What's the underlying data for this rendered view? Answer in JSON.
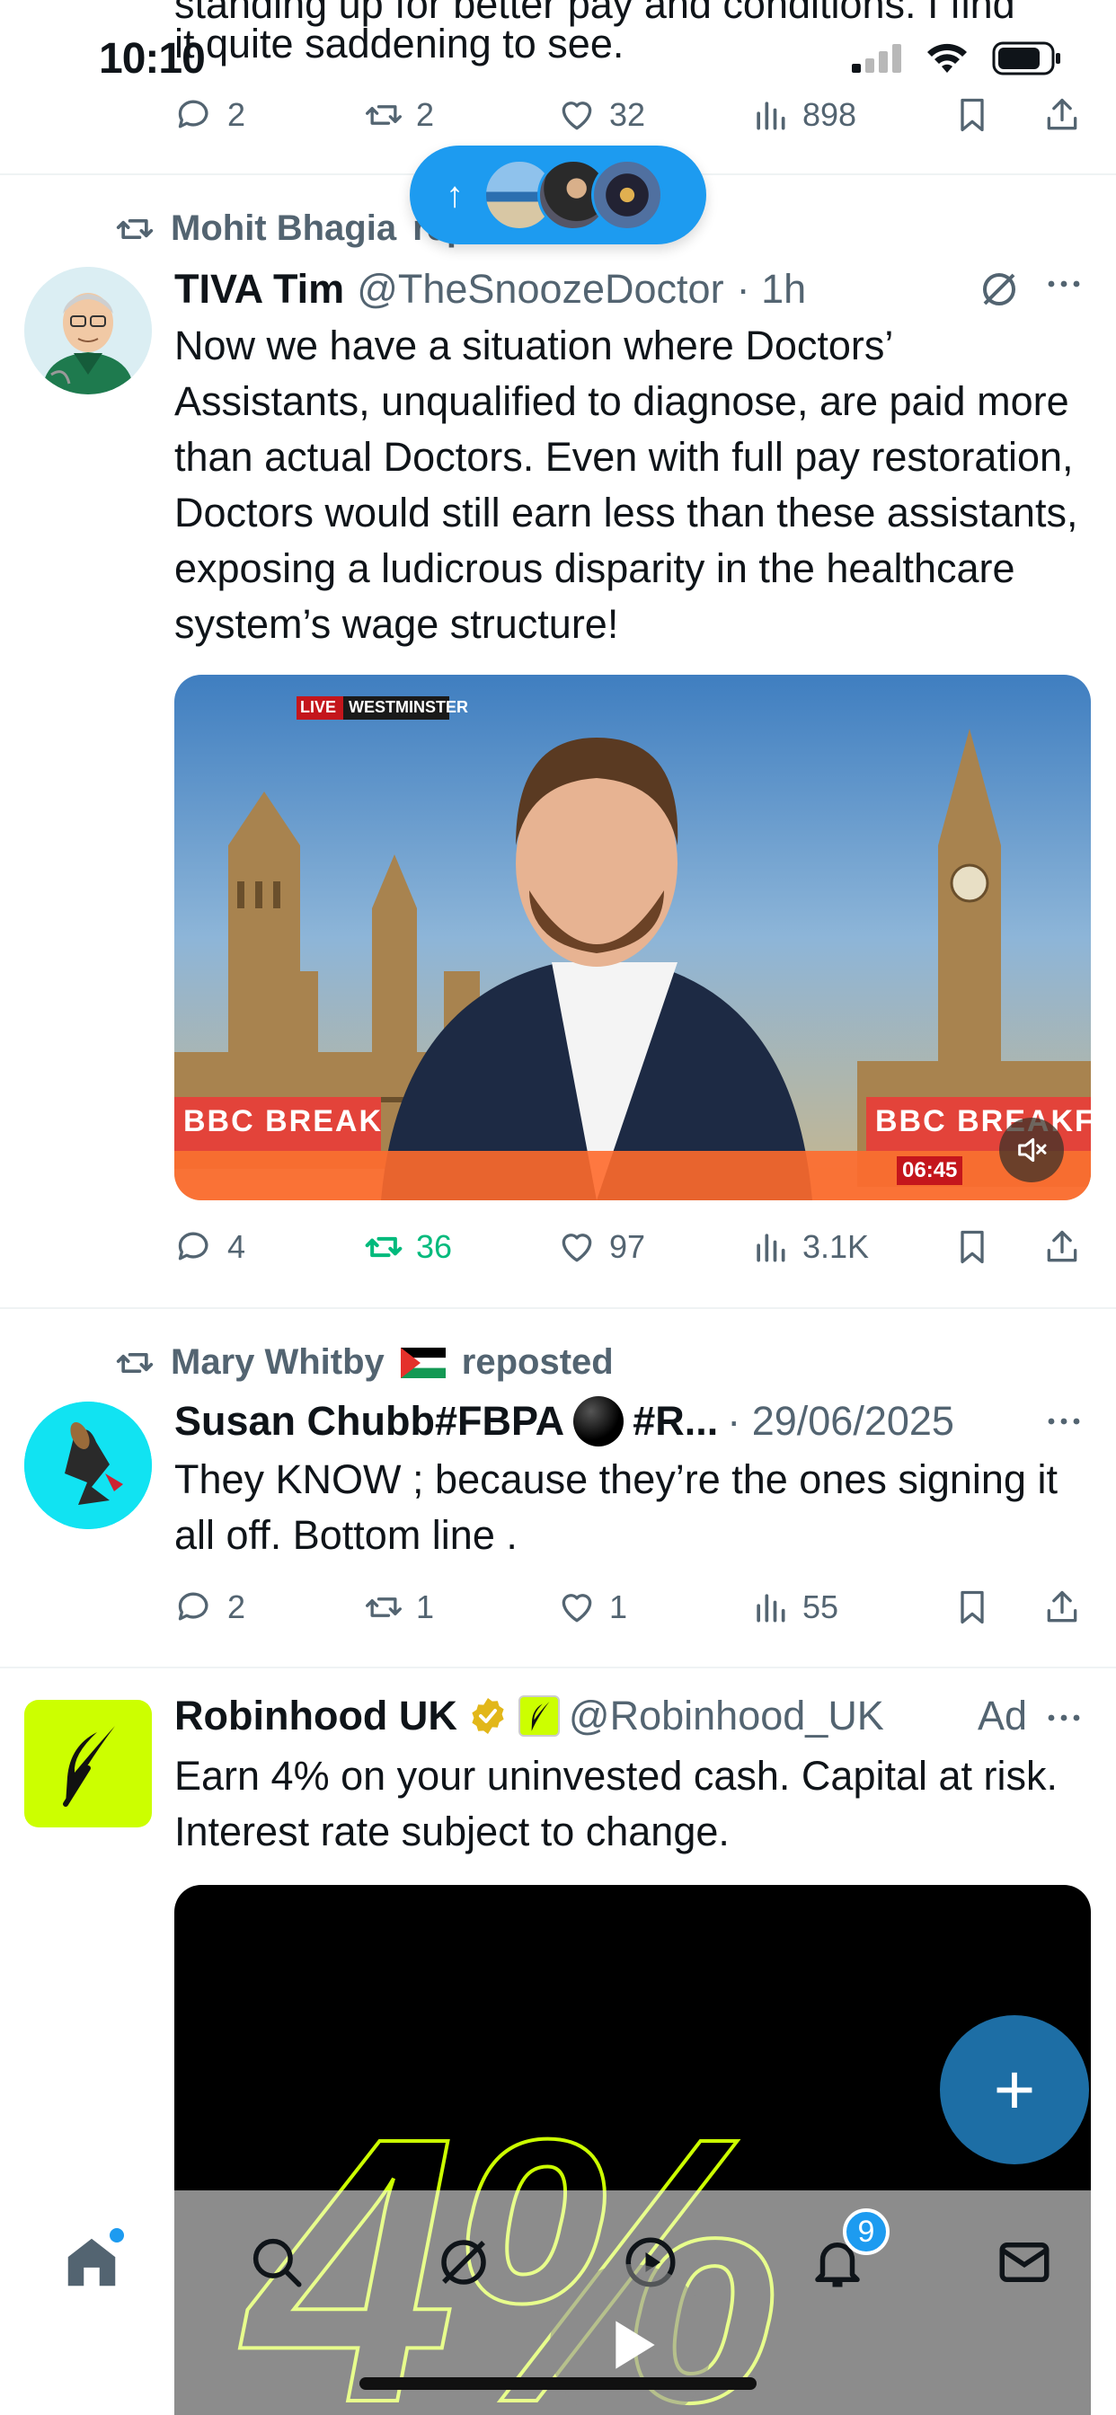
{
  "status_bar": {
    "time": "10:10"
  },
  "top_partial_tweet": {
    "text": "it quite saddening to see.",
    "text_prev": "standing up for better pay and conditions. I find",
    "replies": "2",
    "reposts": "2",
    "likes": "32",
    "views": "898"
  },
  "new_posts_pill": {
    "arrow": "↑"
  },
  "tweet1": {
    "reposted_by": "Mohit Bhagia",
    "reposted_suffix": "reposted",
    "name": "TIVA Tim",
    "handle": "@TheSnoozeDoctor",
    "time": "· 1h",
    "text": "Now we have a situation where Doctors’ Assistants, unqualified to diagnose, are paid more than actual Doctors. Even with full pay restoration, Doctors would still earn less than these assistants, exposing a ludicrous disparity in the healthcare system’s wage structure!",
    "video": {
      "live_label": "LIVE",
      "location_label": "WESTMINSTER",
      "brand_left": "BBC BREAK",
      "brand_right": "BBC BREAKFA",
      "duration": "06:45"
    },
    "replies": "4",
    "reposts": "36",
    "likes": "97",
    "views": "3.1K"
  },
  "tweet2": {
    "reposted_by": "Mary Whitby",
    "reposted_suffix": "reposted",
    "name": "Susan Chubb#FBPA",
    "name_suffix": "#R...",
    "time": "· 29/06/2025",
    "text": "They KNOW ; because they’re the ones signing it all off. Bottom line .",
    "replies": "2",
    "reposts": "1",
    "likes": "1",
    "views": "55"
  },
  "ad": {
    "name": "Robinhood UK",
    "handle": "@Robinhood_UK",
    "ad_label": "Ad",
    "text": "Earn 4% on your uninvested cash. Capital at risk. Interest rate subject to change.",
    "media_text": "4%"
  },
  "bottom_nav": {
    "notifications_badge": "9",
    "items": [
      "home-icon",
      "search-icon",
      "grok-icon",
      "video-icon",
      "notifications-icon",
      "messages-icon"
    ]
  },
  "colors": {
    "accent": "#1d9bf0",
    "repost_green": "#00ba7c",
    "fab": "#1d6ea5",
    "robinhood_lime": "#ccff00"
  }
}
